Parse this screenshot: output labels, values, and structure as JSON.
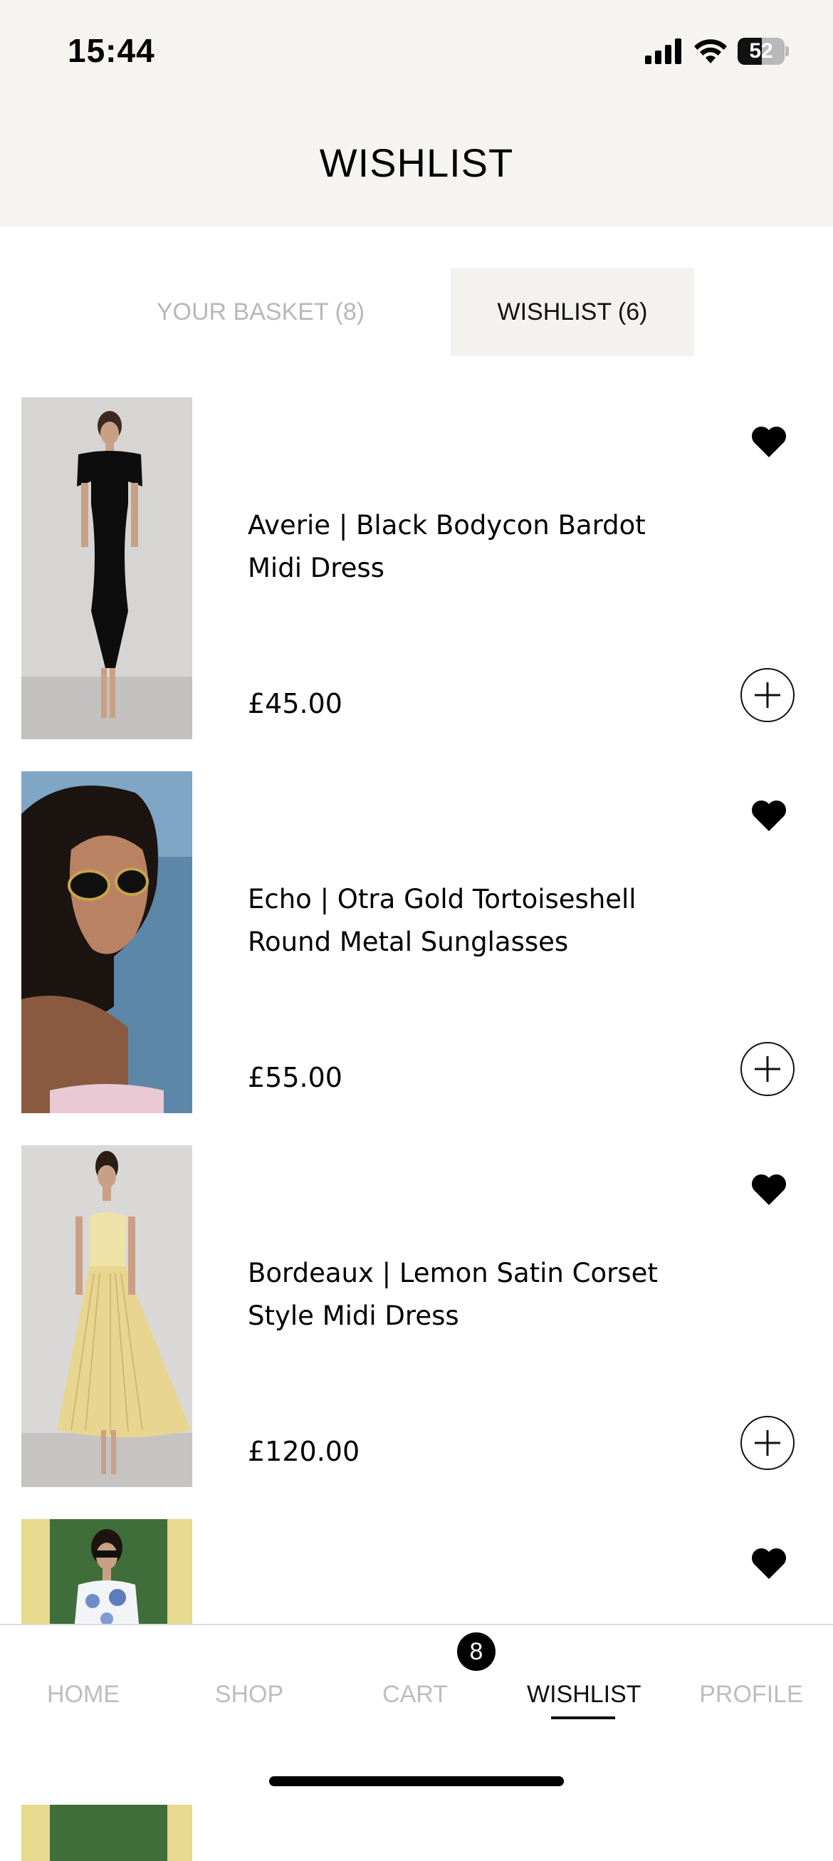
{
  "status_bar": {
    "time": "15:44",
    "battery": "52",
    "battery_level": 0.52
  },
  "header": {
    "title": "WISHLIST"
  },
  "tabs": [
    {
      "label": "YOUR BASKET (8)",
      "active": false
    },
    {
      "label": "WISHLIST (6)",
      "active": true
    }
  ],
  "items": [
    {
      "name": "Averie | Black Bodycon Bardot Midi Dress",
      "price": "£45.00",
      "favorited": true
    },
    {
      "name": "Echo | Otra Gold Tortoiseshell Round Metal Sunglasses",
      "price": "£55.00",
      "favorited": true
    },
    {
      "name": "Bordeaux | Lemon Satin Corset Style Midi Dress",
      "price": "£120.00",
      "favorited": true
    },
    {
      "name": "",
      "price": "",
      "favorited": true
    }
  ],
  "bottom_nav": {
    "items": [
      {
        "label": "HOME"
      },
      {
        "label": "SHOP"
      },
      {
        "label": "CART"
      },
      {
        "label": "WISHLIST"
      },
      {
        "label": "PROFILE"
      }
    ],
    "active": "WISHLIST",
    "cart_badge": "8"
  },
  "icons": {
    "heart": "heart-icon",
    "add": "plus-circle-icon",
    "signal": "cellular-signal-icon",
    "wifi": "wifi-icon",
    "battery": "battery-icon"
  },
  "colors": {
    "header_bg": "#f6f4f0",
    "active_tab_bg": "#f4f2ee",
    "inactive_text": "#b8b8b8"
  }
}
